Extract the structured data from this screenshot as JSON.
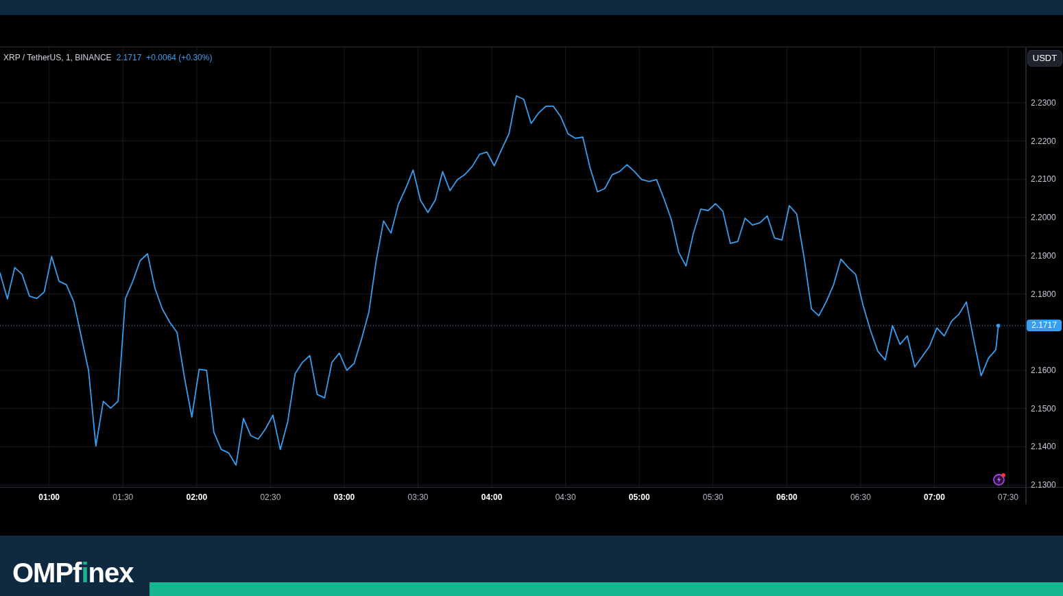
{
  "chart": {
    "legend": {
      "symbol": "XRP / TetherUS, 1, BINANCE",
      "price": "2.1717",
      "change": "+0.0064 (+0.30%)"
    },
    "currency_button": "USDT",
    "last_price_label": "2.1717",
    "chart_data": {
      "type": "line",
      "grid": true,
      "xlim": [
        40,
        472.3
      ],
      "ylim": [
        2.1295,
        2.2445
      ],
      "xticks": [
        {
          "value": 60,
          "label": "01:00"
        },
        {
          "value": 90,
          "label": "01:30"
        },
        {
          "value": 120,
          "label": "02:00"
        },
        {
          "value": 150,
          "label": "02:30"
        },
        {
          "value": 180,
          "label": "03:00"
        },
        {
          "value": 210,
          "label": "03:30"
        },
        {
          "value": 240,
          "label": "04:00"
        },
        {
          "value": 270,
          "label": "04:30"
        },
        {
          "value": 300,
          "label": "05:00"
        },
        {
          "value": 330,
          "label": "05:30"
        },
        {
          "value": 360,
          "label": "06:00"
        },
        {
          "value": 390,
          "label": "06:30"
        },
        {
          "value": 420,
          "label": "07:00"
        },
        {
          "value": 450,
          "label": "07:30"
        }
      ],
      "yticks": [
        {
          "value": 2.23,
          "label": "2.2300"
        },
        {
          "value": 2.22,
          "label": "2.2200"
        },
        {
          "value": 2.21,
          "label": "2.2100"
        },
        {
          "value": 2.2,
          "label": "2.2000"
        },
        {
          "value": 2.19,
          "label": "2.1900"
        },
        {
          "value": 2.18,
          "label": "2.1800"
        },
        {
          "value": 2.16,
          "label": "2.1600"
        },
        {
          "value": 2.15,
          "label": "2.1500"
        },
        {
          "value": 2.14,
          "label": "2.1400"
        },
        {
          "value": 2.13,
          "label": "2.1300"
        }
      ],
      "ref_lines": [
        {
          "axis": "y",
          "value": 2.1717,
          "color": "#379ff1"
        }
      ],
      "x": [
        40,
        43,
        46,
        49,
        52,
        55,
        58,
        61,
        64,
        67,
        70,
        73,
        76,
        79,
        82,
        85,
        88,
        91,
        94,
        97,
        100,
        103,
        106,
        109,
        112,
        115,
        118,
        121,
        124,
        127,
        130,
        133,
        136,
        139,
        142,
        145,
        148,
        151,
        154,
        157,
        160,
        163,
        166,
        169,
        172,
        175,
        178,
        181,
        184,
        187,
        190,
        193,
        196,
        199,
        202,
        205,
        208,
        211,
        214,
        217,
        220,
        223,
        226,
        229,
        232,
        235,
        238,
        241,
        244,
        247,
        250,
        253,
        256,
        259,
        262,
        265,
        268,
        271,
        274,
        277,
        280,
        283,
        286,
        289,
        292,
        295,
        298,
        301,
        304,
        307,
        310,
        313,
        316,
        319,
        322,
        325,
        328,
        331,
        334,
        337,
        340,
        343,
        346,
        349,
        352,
        355,
        358,
        361,
        364,
        367,
        370,
        373,
        376,
        379,
        382,
        385,
        388,
        391,
        394,
        397,
        400,
        403,
        406,
        409,
        412,
        415,
        418,
        421,
        424,
        427,
        430,
        433,
        436,
        439,
        442,
        445,
        446
      ],
      "series": [
        {
          "color": "#379ff1",
          "values": [
            2.1855,
            2.1787,
            2.1869,
            2.1851,
            2.1794,
            2.1788,
            2.1805,
            2.1898,
            2.1833,
            2.1824,
            2.1779,
            2.169,
            2.16,
            2.1402,
            2.1519,
            2.1501,
            2.1519,
            2.1788,
            2.1833,
            2.1887,
            2.1905,
            2.1815,
            2.1761,
            2.1726,
            2.1699,
            2.1582,
            2.1478,
            2.1603,
            2.16,
            2.1438,
            2.1393,
            2.1384,
            2.1352,
            2.1474,
            2.1429,
            2.142,
            2.1447,
            2.1483,
            2.1393,
            2.1465,
            2.1591,
            2.1621,
            2.1639,
            2.1537,
            2.1528,
            2.1621,
            2.1645,
            2.16,
            2.1618,
            2.1681,
            2.1752,
            2.1887,
            2.1991,
            2.1959,
            2.2034,
            2.2076,
            2.2124,
            2.2045,
            2.2013,
            2.2045,
            2.212,
            2.207,
            2.2099,
            2.2112,
            2.2133,
            2.2165,
            2.2171,
            2.2135,
            2.2178,
            2.2219,
            2.2318,
            2.2309,
            2.2246,
            2.2273,
            2.2291,
            2.2291,
            2.2264,
            2.2219,
            2.2207,
            2.221,
            2.2129,
            2.2067,
            2.2076,
            2.2112,
            2.212,
            2.2138,
            2.212,
            2.2099,
            2.2094,
            2.2099,
            2.2049,
            2.1995,
            2.1909,
            2.1873,
            2.1959,
            2.2022,
            2.2018,
            2.2036,
            2.2016,
            2.1932,
            2.1937,
            2.1998,
            2.198,
            2.1986,
            2.2004,
            2.1946,
            2.1941,
            2.2031,
            2.2009,
            2.1896,
            2.1761,
            2.1743,
            2.1779,
            2.1824,
            2.1891,
            2.1869,
            2.1851,
            2.177,
            2.1704,
            2.165,
            2.1627,
            2.1717,
            2.1668,
            2.169,
            2.1609,
            2.1636,
            2.1663,
            2.1711,
            2.169,
            2.1729,
            2.1747,
            2.1779,
            2.1681,
            2.1586,
            2.1632,
            2.1654,
            2.1717
          ]
        }
      ]
    }
  },
  "footer": {
    "logo": [
      {
        "text": "OMPf",
        "accent": false
      },
      {
        "text": "i",
        "accent": true
      },
      {
        "text": "nex",
        "accent": false
      }
    ]
  }
}
